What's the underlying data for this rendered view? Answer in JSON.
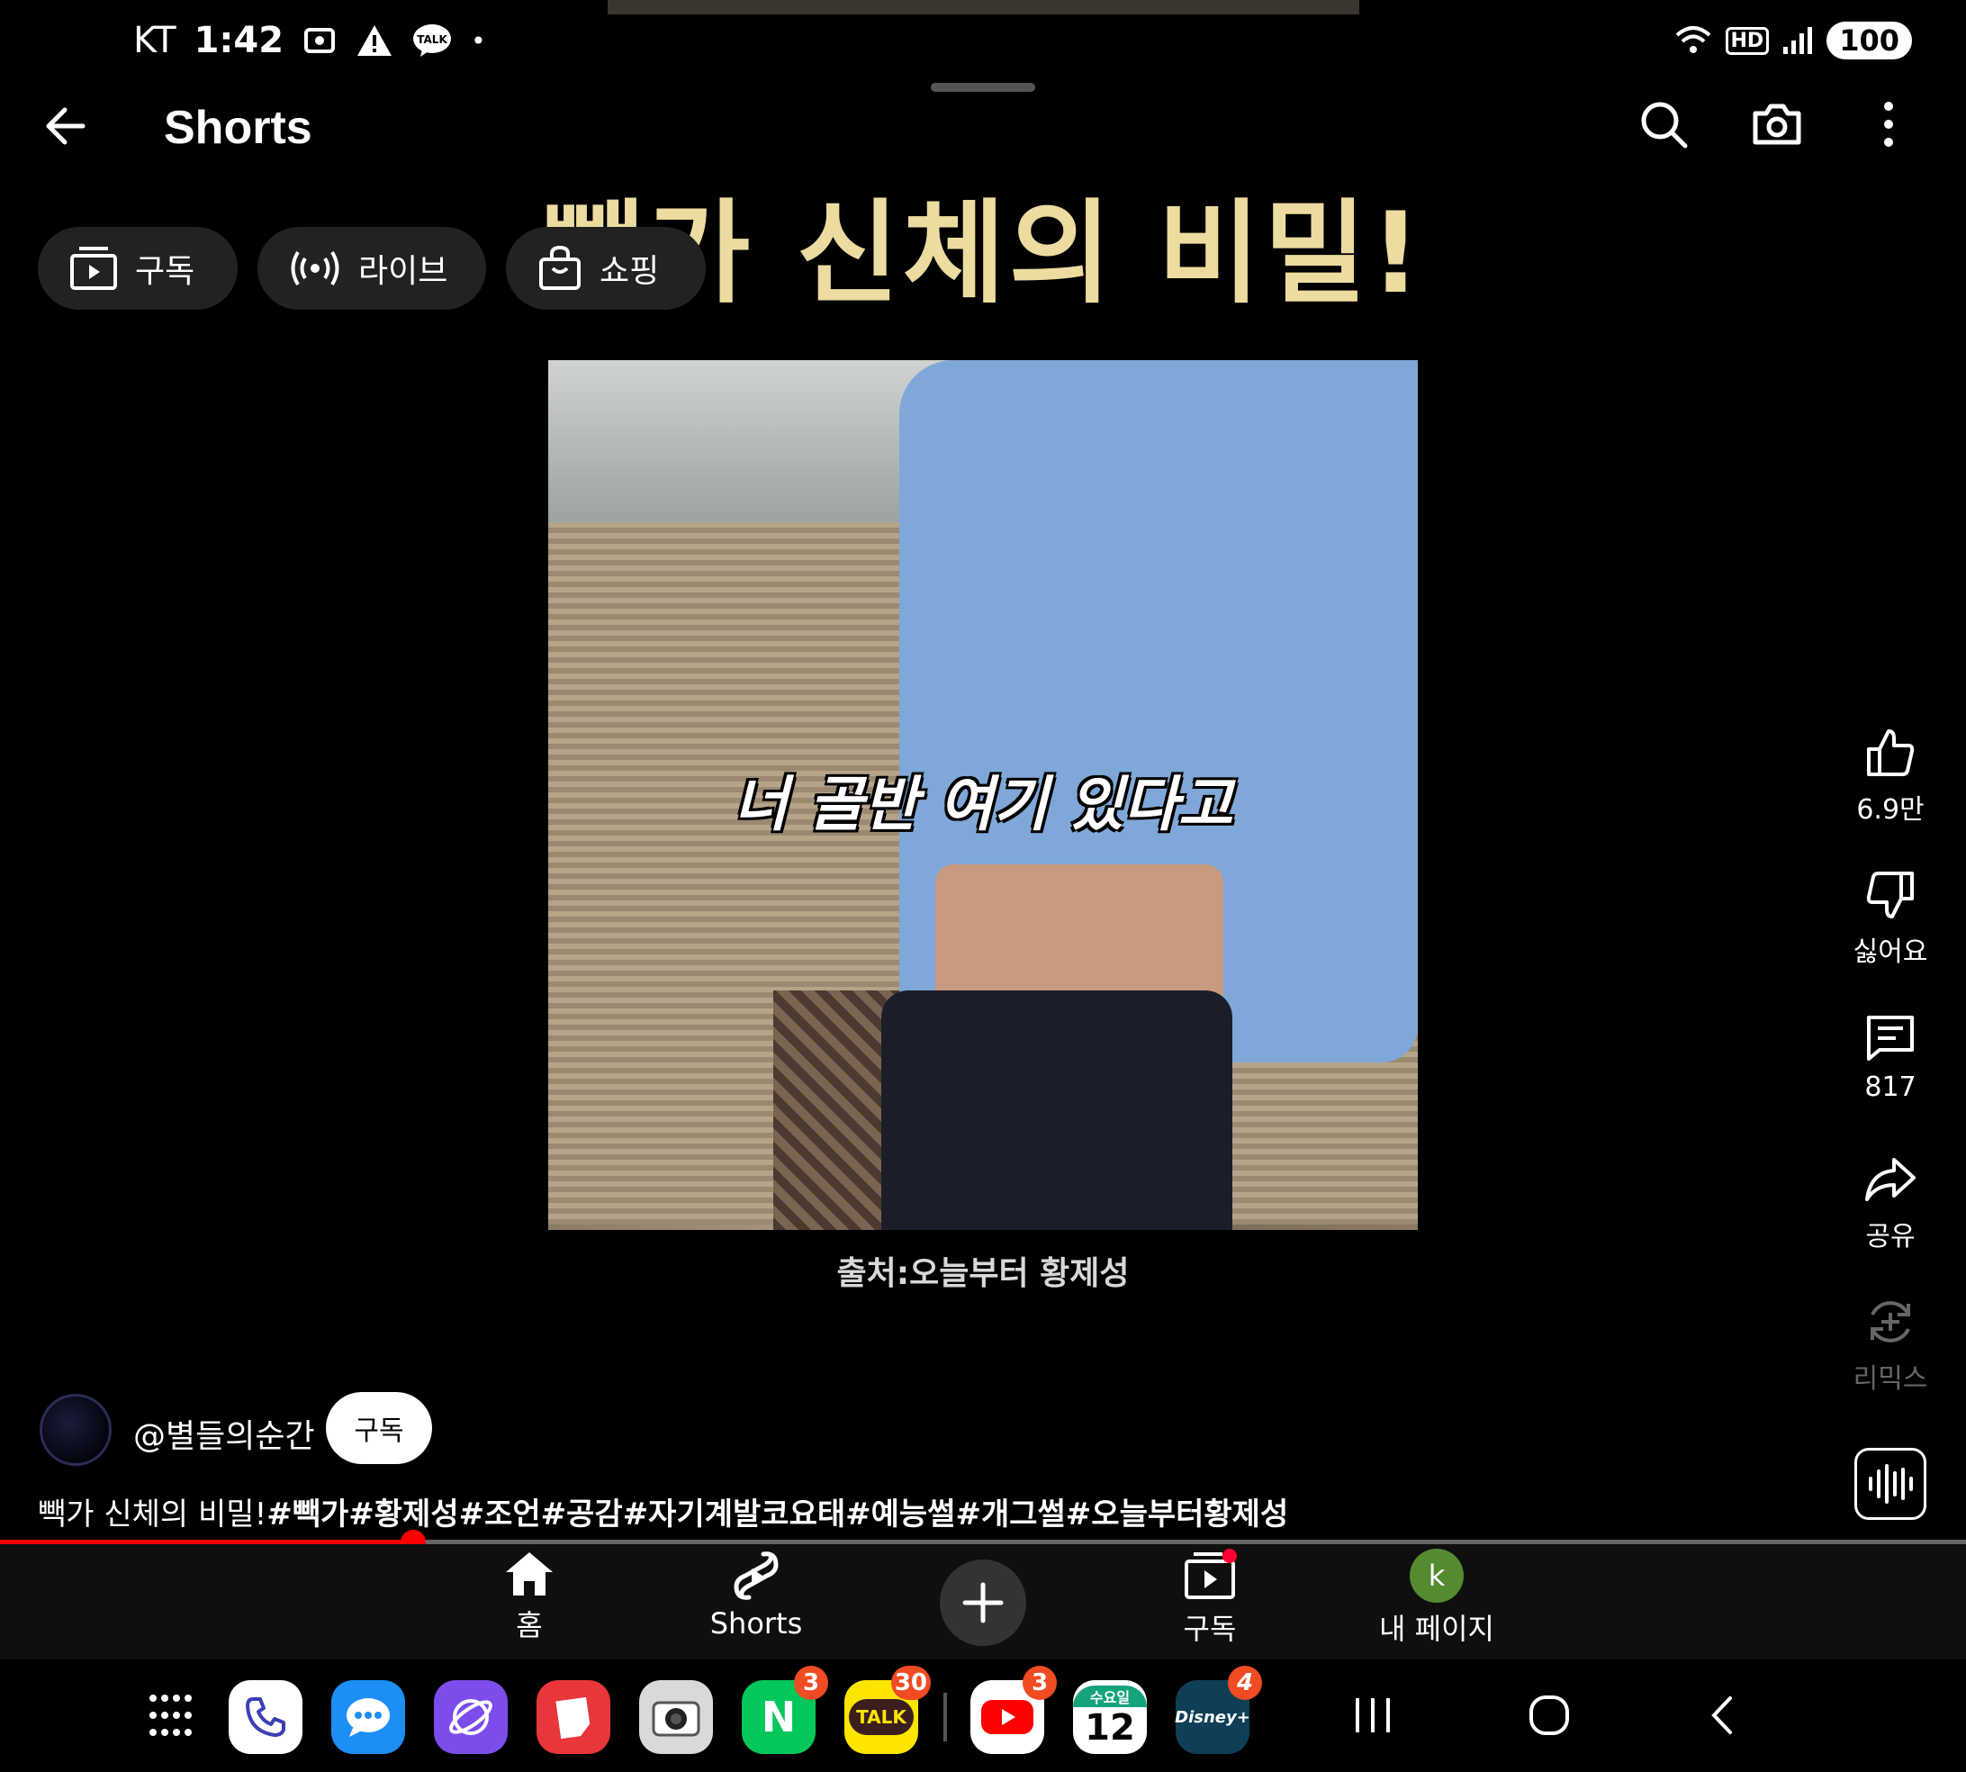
{
  "status_bar": {
    "carrier": "KT",
    "time": "1:42",
    "hd": "HD",
    "battery": "100"
  },
  "header": {
    "title": "Shorts"
  },
  "chips": [
    {
      "label": "구독",
      "icon": "subscriptions-icon"
    },
    {
      "label": "라이브",
      "icon": "live-icon"
    },
    {
      "label": "쇼핑",
      "icon": "shopping-bag-icon"
    }
  ],
  "video": {
    "headline": "빽가 신체의 비밀!",
    "subtitle": "너 골반 여기 있다고",
    "source": "출처:오늘부터 황제성"
  },
  "actions": {
    "like_count": "6.9만",
    "dislike_label": "싫어요",
    "comment_count": "817",
    "share_label": "공유",
    "remix_label": "리믹스"
  },
  "channel": {
    "handle": "@별들의순간",
    "subscribe_label": "구독",
    "description": "빽가 신체의 비밀!",
    "hashtags": "#빽가#황제성#조언#공감#자기계발코요태#예능썰#개그썰#오늘부터황제성"
  },
  "progress": {
    "fraction": 0.21
  },
  "bottom_nav": {
    "home": "홈",
    "shorts": "Shorts",
    "subscriptions": "구독",
    "my_page": "내 페이지",
    "avatar_letter": "k"
  },
  "dock": {
    "apps": [
      {
        "name": "phone",
        "color": "#ffffff",
        "glyph": "",
        "badge": ""
      },
      {
        "name": "messages",
        "color": "#1c8ef5",
        "glyph": "",
        "badge": ""
      },
      {
        "name": "internet",
        "color": "#7b4dea",
        "glyph": "",
        "badge": ""
      },
      {
        "name": "notes",
        "color": "#e8363a",
        "glyph": "",
        "badge": ""
      },
      {
        "name": "camera",
        "color": "#d9d9d9",
        "glyph": "",
        "badge": ""
      },
      {
        "name": "naver",
        "color": "#03c75a",
        "glyph": "N",
        "badge": "3"
      },
      {
        "name": "kakaotalk",
        "color": "#fee500",
        "glyph": "TALK",
        "badge": "30"
      },
      {
        "name": "youtube",
        "color": "#ffffff",
        "glyph": "",
        "badge": "3"
      },
      {
        "name": "calendar",
        "color": "#ffffff",
        "glyph": "12",
        "badge": "",
        "sub": "수요일"
      },
      {
        "name": "disney-plus",
        "color": "#0e3f57",
        "glyph": "Disney+",
        "badge": "4"
      }
    ]
  },
  "colors": {
    "accent_red": "#ff0000",
    "headline_gold": "#ecdca0",
    "chip_bg": "#222222"
  }
}
